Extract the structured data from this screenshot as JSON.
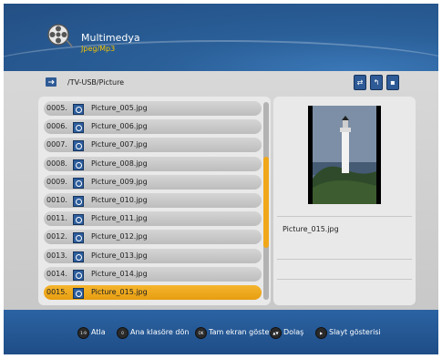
{
  "header": {
    "title": "Multimedya",
    "subtitle": "Jpeg/Mp3",
    "icon": "film-reel-icon"
  },
  "path": {
    "text": "/TV-USB/Picture",
    "icon": "usb-icon"
  },
  "toolbar": {
    "icons": [
      "sort-icon",
      "back-folder-icon",
      "delete-icon"
    ]
  },
  "file_list": {
    "selected_index": 10,
    "rows": [
      {
        "num": "0005.",
        "name": "Picture_005.jpg"
      },
      {
        "num": "0006.",
        "name": "Picture_006.jpg"
      },
      {
        "num": "0007.",
        "name": "Picture_007.jpg"
      },
      {
        "num": "0008.",
        "name": "Picture_008.jpg"
      },
      {
        "num": "0009.",
        "name": "Picture_009.jpg"
      },
      {
        "num": "0010.",
        "name": "Picture_010.jpg"
      },
      {
        "num": "0011.",
        "name": "Picture_011.jpg"
      },
      {
        "num": "0012.",
        "name": "Picture_012.jpg"
      },
      {
        "num": "0013.",
        "name": "Picture_013.jpg"
      },
      {
        "num": "0014.",
        "name": "Picture_014.jpg"
      },
      {
        "num": "0015.",
        "name": "Picture_015.jpg"
      }
    ]
  },
  "preview": {
    "filename": "Picture_015.jpg"
  },
  "footer": {
    "hints": [
      {
        "key": "1-9",
        "label": "Atla"
      },
      {
        "key": "0",
        "label": "Ana klasöre dön"
      },
      {
        "key": "OK",
        "label": "Tam ekran göster"
      },
      {
        "key": "▲▼",
        "label": "Dolaş"
      },
      {
        "key": "▶",
        "label": "Slayt gösterisi"
      }
    ]
  },
  "colors": {
    "background_blue": "#2f5e93",
    "selection_orange": "#f0a81a",
    "subtitle_yellow": "#f5c400"
  }
}
